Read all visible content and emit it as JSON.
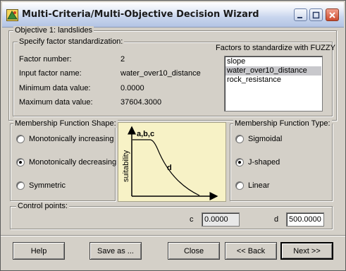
{
  "window": {
    "title": "Multi-Criteria/Multi-Objective Decision Wizard"
  },
  "objective": {
    "label": "Objective 1: landslides"
  },
  "standardization": {
    "legend": "Specify factor standardization:",
    "factor_number_label": "Factor number:",
    "factor_number_value": "2",
    "input_name_label": "Input factor name:",
    "input_name_value": "water_over10_distance",
    "min_label": "Minimum data value:",
    "min_value": "0.0000",
    "max_label": "Maximum data value:",
    "max_value": "37604.3000",
    "factors_title": "Factors to standardize with FUZZY",
    "factors": [
      "slope",
      "water_over10_distance",
      "rock_resistance"
    ],
    "selected_factor": "water_over10_distance"
  },
  "shape": {
    "legend": "Membership Function Shape:",
    "options": [
      "Monotonically increasing",
      "Monotonically decreasing",
      "Symmetric"
    ],
    "selected": "Monotonically decreasing"
  },
  "diagram": {
    "y_label": "suitability",
    "label_abc": "a,b,c",
    "label_d": "d"
  },
  "type": {
    "legend": "Membership Function Type:",
    "options": [
      "Sigmoidal",
      "J-shaped",
      "Linear"
    ],
    "selected": "J-shaped"
  },
  "control_points": {
    "legend": "Control points:",
    "c_label": "c",
    "c_value": "0.0000",
    "d_label": "d",
    "d_value": "500.0000"
  },
  "buttons": {
    "help": "Help",
    "save_as": "Save as ...",
    "close": "Close",
    "back": "<< Back",
    "next": "Next >>"
  }
}
